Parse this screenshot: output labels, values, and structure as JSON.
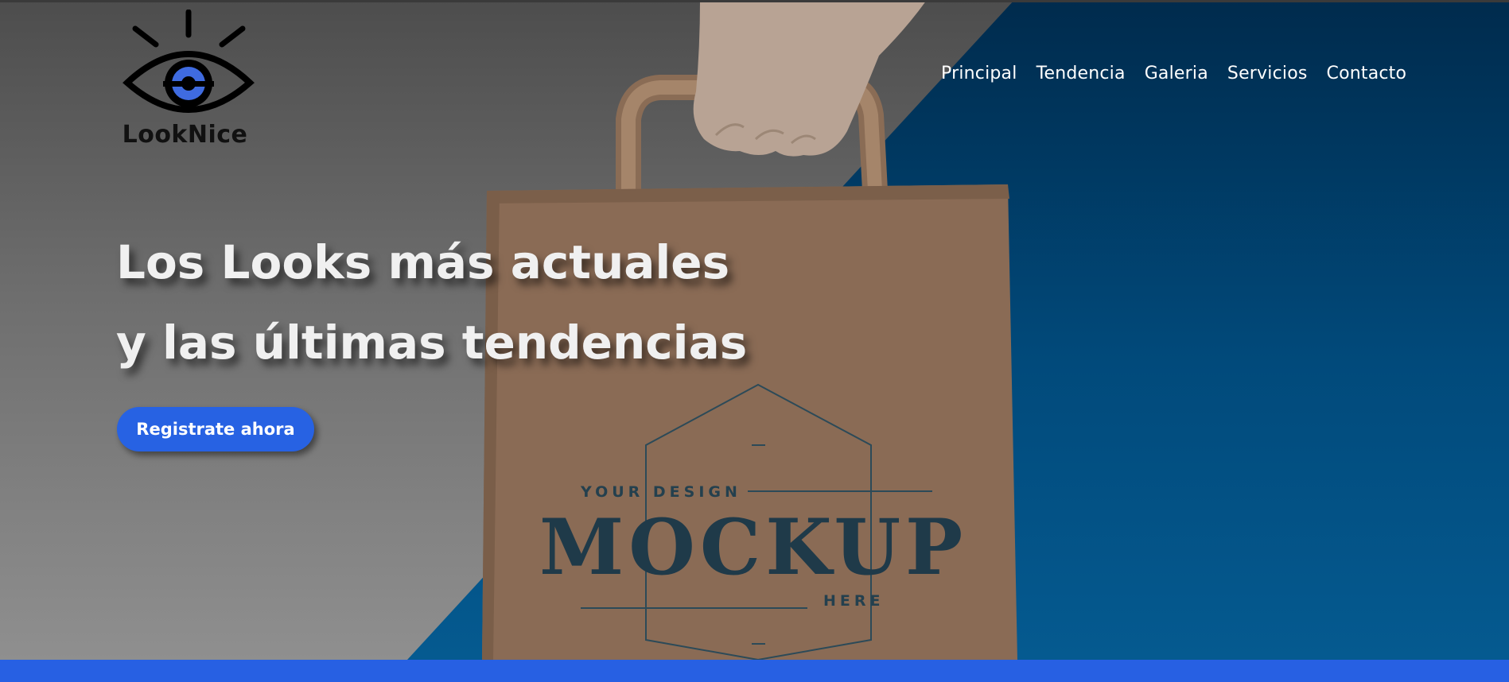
{
  "brand": {
    "name": "LookNice",
    "accent": "#2762e3"
  },
  "nav": {
    "items": [
      "Principal",
      "Tendencia",
      "Galeria",
      "Servicios",
      "Contacto"
    ]
  },
  "hero": {
    "headline": [
      "Los Looks más actuales",
      "y las últimas tendencias"
    ],
    "cta_label": "Registrate ahora",
    "image": {
      "subject": "hand-holding-paper-bag-icon",
      "bag_text": {
        "top": "YOUR DESIGN",
        "main": "MOCKUP",
        "bottom": "HERE"
      }
    }
  },
  "colors": {
    "bottom_bar": "#2760e3",
    "panel_blue": "#014a7b"
  }
}
